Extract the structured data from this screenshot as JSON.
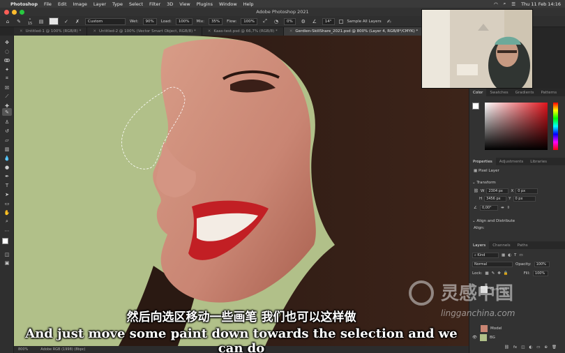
{
  "menubar": {
    "app": "Photoshop",
    "items": [
      "File",
      "Edit",
      "Image",
      "Layer",
      "Type",
      "Select",
      "Filter",
      "3D",
      "View",
      "Plugins",
      "Window",
      "Help"
    ],
    "clock": "Thu 11 Feb  14:16"
  },
  "window": {
    "title": "Adobe Photoshop 2021"
  },
  "options": {
    "brush_size": "15",
    "preset": "Custom",
    "wet_label": "Wet:",
    "wet": "90%",
    "load_label": "Load:",
    "load": "100%",
    "mix_label": "Mix:",
    "mix": "35%",
    "flow_label": "Flow:",
    "flow": "100%",
    "smoothing": "0%",
    "angle": "14°",
    "sample_all": "Sample All Layers"
  },
  "tabs": [
    "Untitled-1 @ 100% (RGB/8) *",
    "Untitled-2 @ 100% (Vector Smart Object, RGB/8) *",
    "Kaas-test.psd @ 66,7% (RGB/8) *",
    "Gerdien-SkillShare_2021.psd @ 800% (Layer 4, RGB/8*/CMYK) *"
  ],
  "color_panel": {
    "tabs": [
      "Color",
      "Swatches",
      "Gradients",
      "Patterns"
    ]
  },
  "properties_panel": {
    "tabs": [
      "Properties",
      "Adjustments",
      "Libraries"
    ],
    "type": "Pixel Layer",
    "transform_label": "Transform",
    "w_label": "W",
    "w": "2304 px",
    "h_label": "H",
    "h": "3456 px",
    "x_label": "X",
    "x": "0 px",
    "y_label": "Y",
    "y": "0 px",
    "angle": "0,00°",
    "align_label": "Align and Distribute",
    "align_sub": "Align:"
  },
  "layers_panel": {
    "tabs": [
      "Layers",
      "Channels",
      "Paths"
    ],
    "kind": "Kind",
    "blend": "Normal",
    "opacity_label": "Opacity:",
    "opacity": "100%",
    "lock_label": "Lock:",
    "fill_label": "Fill:",
    "fill": "100%",
    "layers": [
      "Curves 1",
      "Model",
      "BG"
    ]
  },
  "status": {
    "zoom": "800%",
    "profile": "Adobe RGB (1998) (8bpc)"
  },
  "subtitles": {
    "cn": "然后向选区移动一些画笔 我们也可以这样做",
    "en": "And just move some paint down towards the selection and we can do"
  },
  "watermark": {
    "site": "lingganchina.com",
    "brand": "灵感中国"
  },
  "colors": {
    "canvas_bg": "#b1c089",
    "accent": "#1473e6"
  }
}
